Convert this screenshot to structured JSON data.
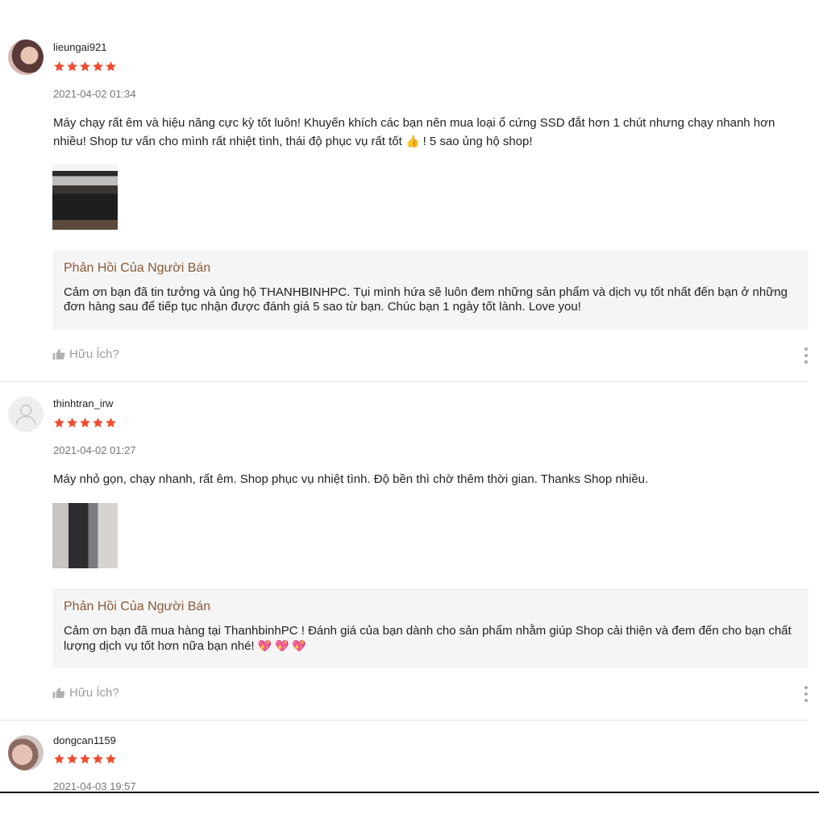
{
  "colors": {
    "star": "#ee4d2d",
    "reply_title": "#8b5a38",
    "reply_bg": "#f5f5f5",
    "muted": "#757575"
  },
  "reviews": [
    {
      "username": "lieungai921",
      "rating": 5,
      "date": "2021-04-02 01:34",
      "comment_main": "Máy chạy rất êm và hiệu năng cực kỳ tốt luôn! Khuyến khích các bạn nên mua loại ổ cứng SSD đắt hơn 1 chút nhưng chạy nhanh hơn nhiều! Shop tư vấn cho mình rất nhiệt tình, thái độ phục vụ rất tốt",
      "comment_emoji": "👍",
      "comment_tail": "! 5 sao ủng hộ shop!",
      "reply_title": "Phản Hồi Của Người Bán",
      "reply_text": "Cảm ơn bạn đã tin tưởng và ủng hộ THANHBINHPC. Tụi mình hứa sẽ luôn đem những sản phẩm và dịch vụ tốt nhất đến bạn ở những đơn hàng sau để tiếp tục nhận được đánh giá 5 sao từ bạn. Chúc bạn 1 ngày tốt lành. Love you!",
      "reply_emojis": "",
      "helpful_label": "Hữu Ích?"
    },
    {
      "username": "thinhtran_irw",
      "rating": 5,
      "date": "2021-04-02 01:27",
      "comment_main": "Máy nhỏ gọn, chạy nhanh, rất êm. Shop phục vụ nhiệt tình. Độ bền thì chờ thêm thời gian. Thanks Shop nhiều.",
      "comment_emoji": "",
      "comment_tail": "",
      "reply_title": "Phản Hồi Của Người Bán",
      "reply_text": "Cảm ơn bạn đã mua hàng tại ThanhbinhPC ! Đánh giá của bạn dành cho sản phẩm nhằm giúp Shop cải thiện và đem đến cho bạn chất lượng dịch vụ tốt hơn nữa bạn nhé!",
      "reply_emojis": "💖 💖 💖",
      "helpful_label": "Hữu Ích?"
    },
    {
      "username": "dongcan1159",
      "rating": 5,
      "date": "2021-04-03 19:57"
    }
  ]
}
